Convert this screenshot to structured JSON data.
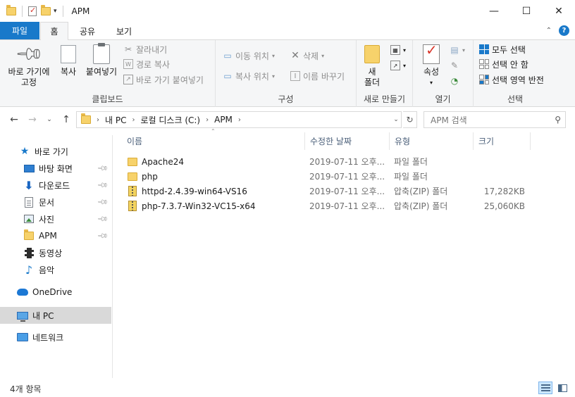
{
  "window": {
    "title": "APM",
    "controls": {
      "minimize": "—",
      "maximize": "☐",
      "close": "✕"
    }
  },
  "tabs": {
    "file": "파일",
    "items": [
      "홈",
      "공유",
      "보기"
    ],
    "active": "홈"
  },
  "ribbon": {
    "clipboard": {
      "label": "클립보드",
      "pin_quick": "바로 가기에\n고정",
      "copy": "복사",
      "paste": "붙여넣기",
      "cut": "잘라내기",
      "copy_path": "경로 복사",
      "paste_shortcut": "바로 가기 붙여넣기"
    },
    "organize": {
      "label": "구성",
      "move_to": "이동 위치",
      "copy_to": "복사 위치",
      "delete": "삭제",
      "rename": "이름 바꾸기"
    },
    "new": {
      "label": "새로 만들기",
      "new_folder": "새\n폴더"
    },
    "open": {
      "label": "열기",
      "properties": "속성"
    },
    "select": {
      "label": "선택",
      "select_all": "모두 선택",
      "select_none": "선택 안 함",
      "invert": "선택 영역 반전"
    }
  },
  "address": {
    "crumbs": [
      "내 PC",
      "로컬 디스크 (C:)",
      "APM"
    ],
    "search_placeholder": "APM 검색"
  },
  "navpane": {
    "quick_access": "바로 가기",
    "items": [
      {
        "label": "바탕 화면",
        "icon": "desktop-icon",
        "pinned": true
      },
      {
        "label": "다운로드",
        "icon": "download-icon",
        "pinned": true
      },
      {
        "label": "문서",
        "icon": "document-icon",
        "pinned": true
      },
      {
        "label": "사진",
        "icon": "picture-icon",
        "pinned": true
      },
      {
        "label": "APM",
        "icon": "folder-icon",
        "pinned": true
      },
      {
        "label": "동영상",
        "icon": "video-icon",
        "pinned": false
      },
      {
        "label": "음악",
        "icon": "music-icon",
        "pinned": false
      }
    ],
    "onedrive": "OneDrive",
    "this_pc": "내 PC",
    "network": "네트워크"
  },
  "filelist": {
    "columns": {
      "name": "이름",
      "date": "수정한 날짜",
      "type": "유형",
      "size": "크기"
    },
    "rows": [
      {
        "name": "Apache24",
        "date": "2019-07-11 오후...",
        "type": "파일 폴더",
        "size": "",
        "icon": "folder"
      },
      {
        "name": "php",
        "date": "2019-07-11 오후...",
        "type": "파일 폴더",
        "size": "",
        "icon": "folder"
      },
      {
        "name": "httpd-2.4.39-win64-VS16",
        "date": "2019-07-11 오후...",
        "type": "압축(ZIP) 폴더",
        "size": "17,282KB",
        "icon": "zip"
      },
      {
        "name": "php-7.3.7-Win32-VC15-x64",
        "date": "2019-07-11 오후...",
        "type": "압축(ZIP) 폴더",
        "size": "25,060KB",
        "icon": "zip"
      }
    ]
  },
  "status": {
    "item_count": "4개 항목"
  },
  "colors": {
    "accent": "#1979ca",
    "ribbon_bg": "#f5f6f7",
    "selected_bg": "#d9d9d9"
  }
}
